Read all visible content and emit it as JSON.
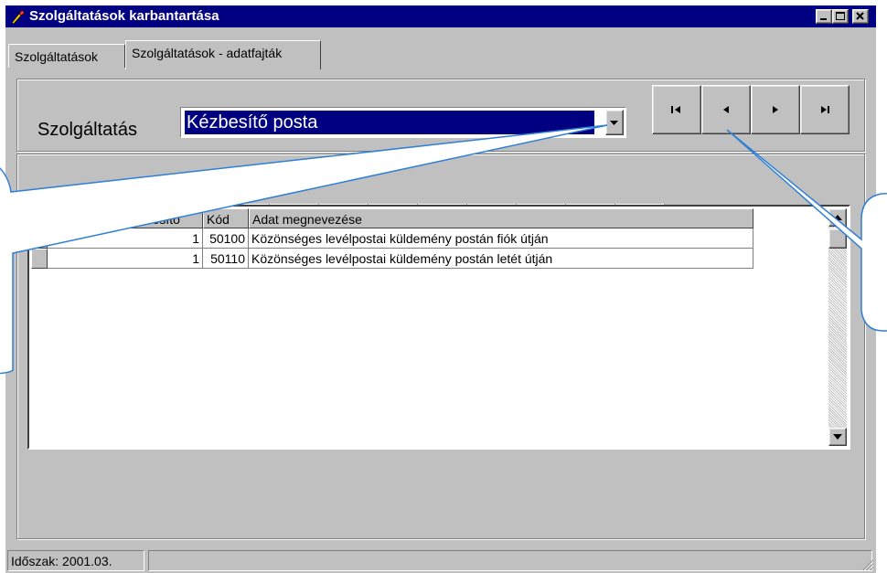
{
  "window": {
    "title": "Szolgáltatások karbantartása"
  },
  "tabs": [
    {
      "label": "Szolgáltatások",
      "active": false
    },
    {
      "label": "Szolgáltatások - adatfajták",
      "active": true
    }
  ],
  "service": {
    "label": "Szolgáltatás",
    "selected": "Kézbesítő posta"
  },
  "record_navigator": [
    "first-icon",
    "prior-icon",
    "next-icon",
    "last-icon"
  ],
  "grid_navigator": [
    {
      "icon": "first-icon",
      "enabled": false
    },
    {
      "icon": "prior-icon",
      "enabled": false
    },
    {
      "icon": "next-icon",
      "enabled": true
    },
    {
      "icon": "last-icon",
      "enabled": true
    },
    {
      "icon": "plus-icon",
      "enabled": true
    },
    {
      "icon": "minus-icon",
      "enabled": true
    },
    {
      "icon": "edit-icon",
      "enabled": true
    },
    {
      "icon": "check-icon",
      "enabled": false
    },
    {
      "icon": "cancel-icon",
      "enabled": false
    }
  ],
  "grid": {
    "columns": [
      "Szolgáltatás azonosító",
      "Kód",
      "Adat megnevezése"
    ],
    "rows": [
      {
        "service_id": "1",
        "code": "50100",
        "name": "Közönséges levélpostai küldemény postán fiók útján",
        "current": true
      },
      {
        "service_id": "1",
        "code": "50110",
        "name": "Közönséges levélpostai küldemény postán letét útján",
        "current": false
      }
    ]
  },
  "status": {
    "period": "Időszak: 2001.03."
  },
  "colors": {
    "titlebar": "#000080",
    "face": "#c0c0c0",
    "callout_border": "#2f7fd6"
  }
}
